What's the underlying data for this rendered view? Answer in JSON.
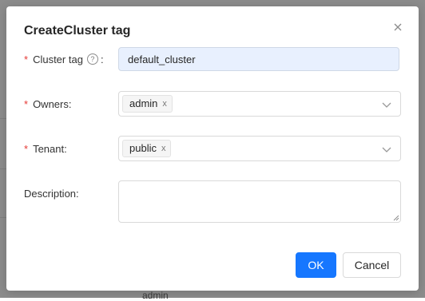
{
  "background": {
    "partial_text": "admin"
  },
  "dialog": {
    "title": "CreateCluster tag",
    "close_icon": "close-icon",
    "fields": {
      "cluster_tag": {
        "required": "*",
        "label": "Cluster tag",
        "help_icon": "question-circle-icon",
        "help_glyph": "?",
        "colon": ":",
        "value": "default_cluster"
      },
      "owners": {
        "required": "*",
        "label": "Owners:",
        "tags": [
          "admin"
        ],
        "tag_close_glyph": "x",
        "dropdown_icon": "chevron-down-icon"
      },
      "tenant": {
        "required": "*",
        "label": "Tenant:",
        "tags": [
          "public"
        ],
        "tag_close_glyph": "x",
        "dropdown_icon": "chevron-down-icon"
      },
      "description": {
        "label": "Description:",
        "value": ""
      }
    },
    "buttons": {
      "ok": "OK",
      "cancel": "Cancel"
    },
    "colors": {
      "primary": "#1677ff",
      "required": "#e53935",
      "autofill_bg": "#e8f0fe"
    }
  }
}
